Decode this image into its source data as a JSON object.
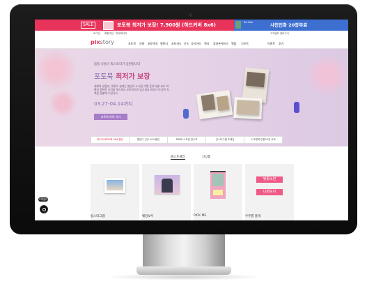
{
  "banner": {
    "sale_badge": "SALE",
    "promo_text": "포토북 최저가 보장! 7,900원 (하드커버 8x6)",
    "promo2_small": "Re:Sale",
    "promo2_text": "사진인화 20장무료"
  },
  "utility": {
    "links": [
      "로그인",
      "회원가입",
      "마이페이지",
      "고객센터",
      "장바구니"
    ]
  },
  "nav": {
    "logo_main": "pix",
    "logo_sub": "story",
    "items": [
      "포토북",
      "인화",
      "포토액자",
      "캘린더",
      "포토카드",
      "굿즈",
      "다이어리",
      "액자",
      "휴대폰케이스",
      "앨범",
      "기프트"
    ],
    "right": [
      "이벤트",
      "후기"
    ]
  },
  "hero": {
    "small": "봄을 나들이 픽스토리가 응원합니다",
    "title_light": "포토북",
    "title_bold": "최저가 보장",
    "description": "새해의 설렘과, 벚꽃이 설레는 봄날의 소식을 여행 준비하셨나요? 여행의 행복한 추억을 픽스토리 포토북으로 남기세요 최저가 아니면 차액을 환불해 드립니다",
    "date": "03.27-04.14까지",
    "button": "포토북 바로 가기"
  },
  "promo_tabs": [
    "하드커버포토북 6X8 할인",
    "캘린더 신규 40%할인",
    "포토북 스프링 방수포",
    "인스타그램 프레임",
    "스크랩북 만원20장 무료"
  ],
  "section_tabs": [
    "베스트셀러",
    "신상품"
  ],
  "cards": [
    {
      "label": "컴스타그램"
    },
    {
      "label": "웨딩보우"
    },
    {
      "label": "PICK ME"
    },
    {
      "label": "우주를 줄게"
    }
  ],
  "card4_overlay": {
    "line1": "벚꽃소연",
    "line2": "니편보이"
  },
  "chat": {
    "label": "고객센터"
  },
  "colors": {
    "brand": "#e8335a",
    "hero_bg": "#e7d4e8",
    "accent_purple": "#a77cc9",
    "promo_blue": "#3d6fd1"
  }
}
